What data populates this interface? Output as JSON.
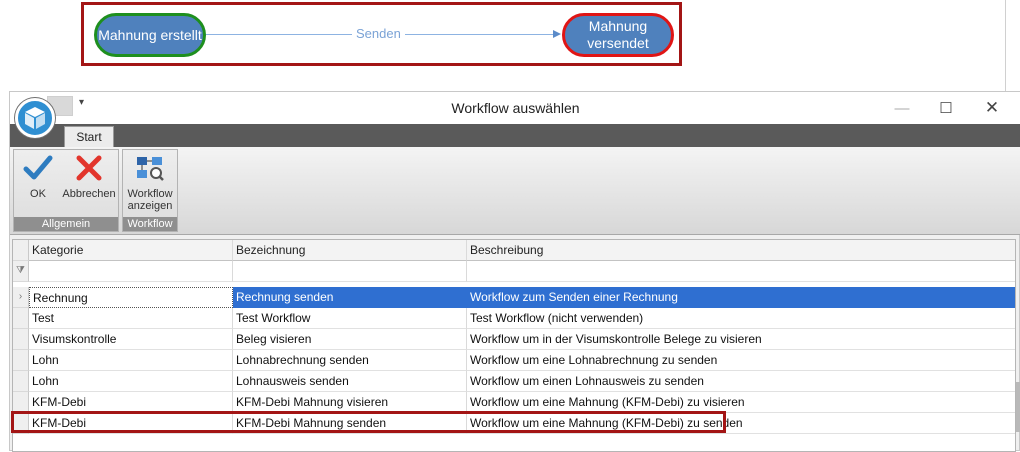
{
  "flow": {
    "start_node": "Mahnung erstellt",
    "edge_label": "Senden",
    "end_node_line1": "Mahnung",
    "end_node_line2": "versendet"
  },
  "window": {
    "title": "Workflow auswählen",
    "quick_access_dropdown": "▾",
    "minimize_glyph": "—",
    "maximize_glyph": "☐",
    "close_glyph": "✕"
  },
  "ribbon": {
    "tab_label": "Start",
    "groups": [
      {
        "label": "Allgemein",
        "buttons": [
          {
            "label": "OK",
            "icon": "check-icon"
          },
          {
            "label": "Abbrechen",
            "icon": "cross-icon"
          }
        ]
      },
      {
        "label": "Workflow",
        "buttons": [
          {
            "label_line1": "Workflow",
            "label_line2": "anzeigen",
            "icon": "workflow-view-icon"
          }
        ]
      }
    ]
  },
  "grid": {
    "filter_icon": "⧩",
    "row_indicator": "›",
    "columns": [
      "Kategorie",
      "Bezeichnung",
      "Beschreibung"
    ],
    "rows": [
      {
        "kategorie": "Rechnung",
        "bezeichnung": "Rechnung senden",
        "beschreibung": "Workflow zum Senden einer Rechnung"
      },
      {
        "kategorie": "Test",
        "bezeichnung": "Test Workflow",
        "beschreibung": "Test Workflow (nicht verwenden)"
      },
      {
        "kategorie": "Visumskontrolle",
        "bezeichnung": "Beleg visieren",
        "beschreibung": "Workflow um in der Visumskontrolle Belege zu visieren"
      },
      {
        "kategorie": "Lohn",
        "bezeichnung": "Lohnabrechnung senden",
        "beschreibung": "Workflow um eine Lohnabrechnung zu senden"
      },
      {
        "kategorie": "Lohn",
        "bezeichnung": "Lohnausweis senden",
        "beschreibung": "Workflow um einen Lohnausweis zu senden"
      },
      {
        "kategorie": "KFM-Debi",
        "bezeichnung": "KFM-Debi Mahnung visieren",
        "beschreibung": "Workflow um eine Mahnung (KFM-Debi) zu visieren"
      },
      {
        "kategorie": "KFM-Debi",
        "bezeichnung": "KFM-Debi Mahnung senden",
        "beschreibung": "Workflow um eine Mahnung (KFM-Debi) zu senden"
      }
    ]
  },
  "colors": {
    "selection": "#2f6fd1",
    "highlight_border": "#a31515",
    "node_fill": "#4f81bd",
    "start_border": "#1e8f1e",
    "end_border": "#e01515"
  }
}
